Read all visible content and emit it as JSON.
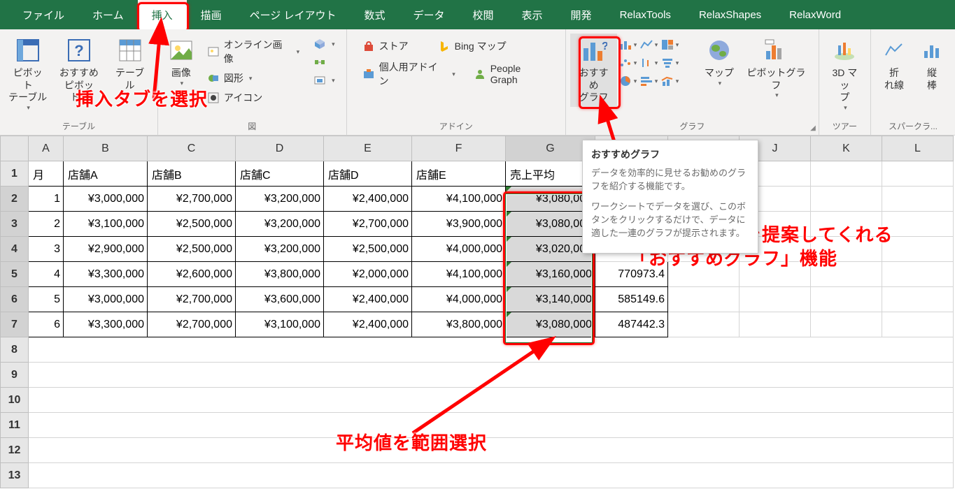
{
  "tabs": {
    "file": "ファイル",
    "home": "ホーム",
    "insert": "挿入",
    "draw": "描画",
    "pagelayout": "ページ レイアウト",
    "formulas": "数式",
    "data": "データ",
    "review": "校閲",
    "view": "表示",
    "dev": "開発",
    "relax1": "RelaxTools",
    "relax2": "RelaxShapes",
    "relax3": "RelaxWord"
  },
  "groups": {
    "tables": {
      "label": "テーブル",
      "pivot": "ピボット\nテーブル",
      "recpivot": "おすすめ\nピボット...",
      "table": "テーブル"
    },
    "illust": {
      "label": "図",
      "pic": "画像",
      "online": "オンライン画像",
      "shapes": "図形",
      "icons": "アイコン",
      "model3d": "",
      "smartart": "",
      "screenshot": ""
    },
    "addins": {
      "label": "アドイン",
      "store": "ストア",
      "myaddins": "個人用アドイン",
      "bing": "Bing マップ",
      "people": "People Graph"
    },
    "charts": {
      "label": "グラフ",
      "recommend": "おすすめ\nグラフ",
      "map": "マップ",
      "pivotchart": "ピボットグラフ"
    },
    "tours": {
      "label": "ツアー",
      "map3d": "3D マッ\nプ"
    },
    "spark": {
      "label": "スパークラ...",
      "line": "折\nれ線",
      "col": "縦\n棒"
    }
  },
  "tooltip": {
    "title": "おすすめグラフ",
    "p1": "データを効率的に見せるお勧めのグラフを紹介する機能です。",
    "p2": "ワークシートでデータを選び、このボタンをクリックするだけで、データに適した一連のグラフが提示されます。"
  },
  "annotations": {
    "a1": "挿入タブを選択",
    "a2": "最適なグラフを提案してくれる\n「おすすめグラフ」機能",
    "a3": "平均値を範囲選択"
  },
  "columns": [
    "A",
    "B",
    "C",
    "D",
    "E",
    "F",
    "G",
    "H",
    "I",
    "J",
    "K",
    "L"
  ],
  "headers": {
    "A": "月",
    "B": "店舗A",
    "C": "店舗B",
    "D": "店舗C",
    "E": "店舗D",
    "F": "店舗E",
    "G": "売上平均"
  },
  "rows": [
    {
      "A": "1",
      "B": "¥3,000,000",
      "C": "¥2,700,000",
      "D": "¥3,200,000",
      "E": "¥2,400,000",
      "F": "¥4,100,000",
      "G": "¥3,080,000",
      "H": ""
    },
    {
      "A": "2",
      "B": "¥3,100,000",
      "C": "¥2,500,000",
      "D": "¥3,200,000",
      "E": "¥2,700,000",
      "F": "¥3,900,000",
      "G": "¥3,080,000",
      "H": ""
    },
    {
      "A": "3",
      "B": "¥2,900,000",
      "C": "¥2,500,000",
      "D": "¥3,200,000",
      "E": "¥2,500,000",
      "F": "¥4,000,000",
      "G": "¥3,020,000",
      "H": ""
    },
    {
      "A": "4",
      "B": "¥3,300,000",
      "C": "¥2,600,000",
      "D": "¥3,800,000",
      "E": "¥2,000,000",
      "F": "¥4,100,000",
      "G": "¥3,160,000",
      "H": "770973.4"
    },
    {
      "A": "5",
      "B": "¥3,000,000",
      "C": "¥2,700,000",
      "D": "¥3,600,000",
      "E": "¥2,400,000",
      "F": "¥4,000,000",
      "G": "¥3,140,000",
      "H": "585149.6"
    },
    {
      "A": "6",
      "B": "¥3,300,000",
      "C": "¥2,700,000",
      "D": "¥3,100,000",
      "E": "¥2,400,000",
      "F": "¥3,800,000",
      "G": "¥3,080,000",
      "H": "487442.3"
    }
  ],
  "chart_data": null
}
